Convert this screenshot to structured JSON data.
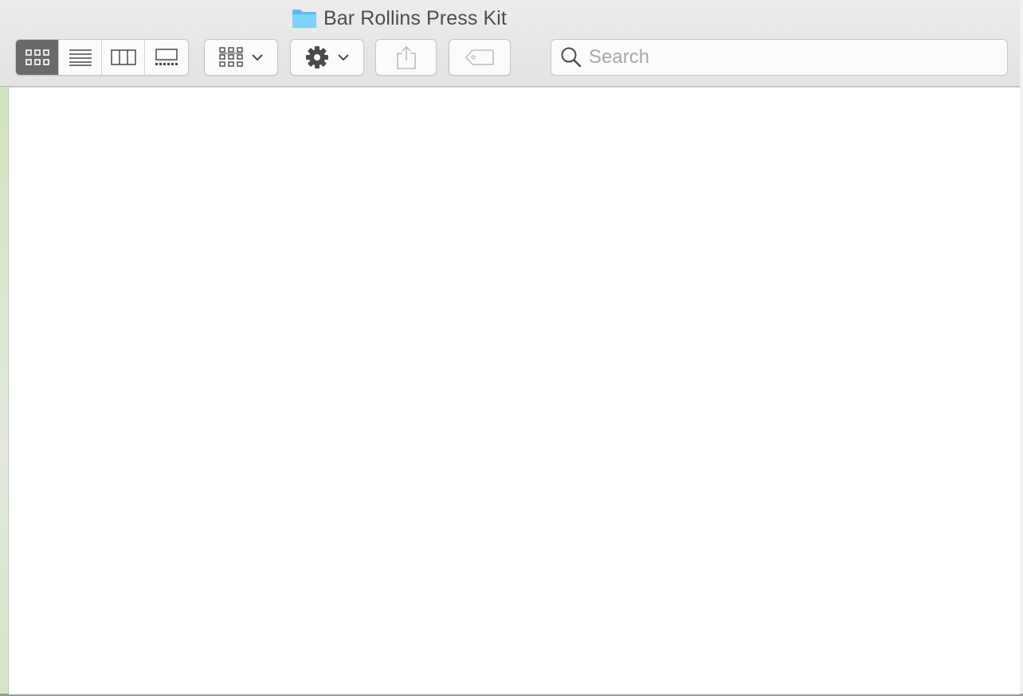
{
  "window": {
    "title": "Bar Rollins Press Kit",
    "title_icon": "folder-icon"
  },
  "toolbar": {
    "view_modes": [
      {
        "name": "icon-view",
        "icon": "icon-grid-icon",
        "active": true
      },
      {
        "name": "list-view",
        "icon": "list-lines-icon",
        "active": false
      },
      {
        "name": "column-view",
        "icon": "columns-icon",
        "active": false
      },
      {
        "name": "gallery-view",
        "icon": "gallery-icon",
        "active": false
      }
    ],
    "group_button_icon": "group-grid-icon",
    "action_button_icon": "gear-icon",
    "share_button_icon": "share-icon",
    "tag_button_icon": "tag-icon"
  },
  "search": {
    "placeholder": "Search",
    "value": ""
  },
  "colors": {
    "toolbar_bg": "#e6e6e6",
    "active_segment": "#6a6a6a",
    "folder_blue": "#6cc4f5"
  }
}
